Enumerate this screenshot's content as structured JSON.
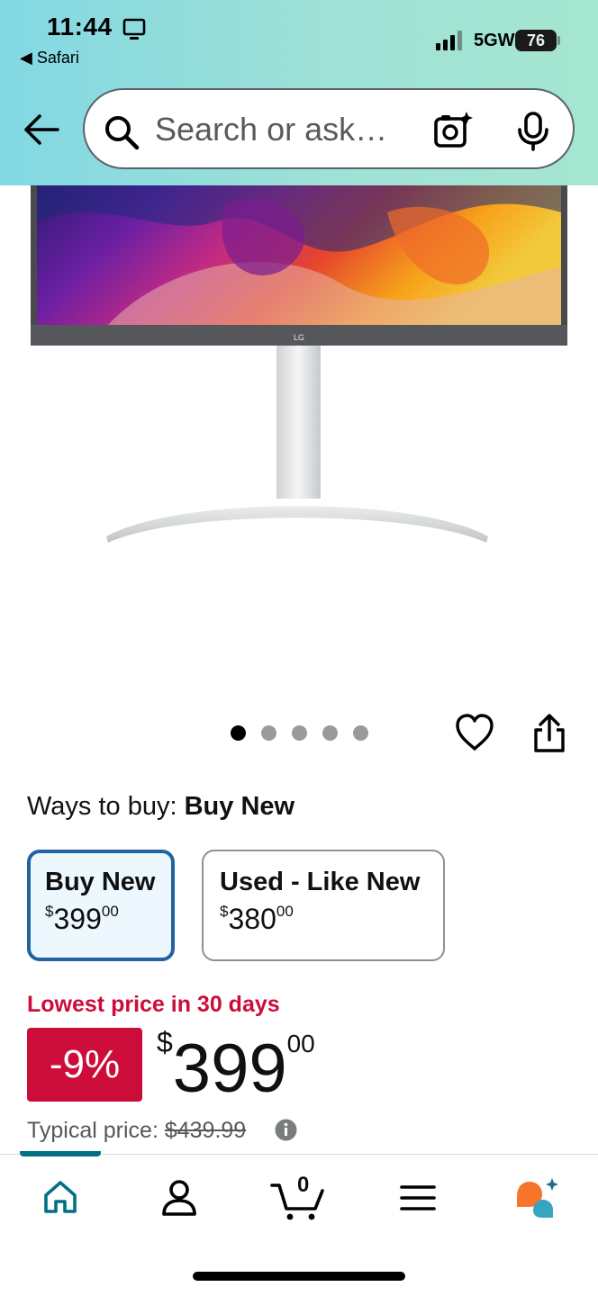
{
  "status_bar": {
    "time": "11:44",
    "back_app": "◀ Safari",
    "network": "5GW",
    "battery": "76"
  },
  "search": {
    "placeholder": "Search or ask…"
  },
  "product": {
    "image_alt": "LG monitor",
    "brand_logo_text": "LG"
  },
  "carousel": {
    "total_images": 5,
    "active_index": 0
  },
  "ways_to_buy": {
    "label": "Ways to buy:",
    "selected": "Buy New"
  },
  "buy_options": [
    {
      "title": "Buy New",
      "currency": "$",
      "whole": "399",
      "fraction": "00",
      "selected": true
    },
    {
      "title": "Used - Like New",
      "currency": "$",
      "whole": "380",
      "fraction": "00",
      "selected": false
    }
  ],
  "price": {
    "deal_label": "Lowest price in 30 days",
    "discount": "-9%",
    "currency": "$",
    "whole": "399",
    "fraction": "00",
    "typical_label": "Typical price:",
    "typical_value": "$439.99"
  },
  "bottom_nav": {
    "cart_count": "0",
    "items": [
      "home-icon",
      "account-icon",
      "cart-icon",
      "menu-icon",
      "rufus-ai-icon"
    ],
    "active": "home-icon"
  },
  "colors": {
    "header_gradient_start": "#82d8e3",
    "header_gradient_end": "#a5e6d0",
    "deal_red": "#cc0c39",
    "selected_border": "#2162a1",
    "selected_bg": "#edf7fe",
    "nav_teal": "#007185",
    "ai_orange": "#f7742b",
    "ai_teal": "#36a6be"
  }
}
